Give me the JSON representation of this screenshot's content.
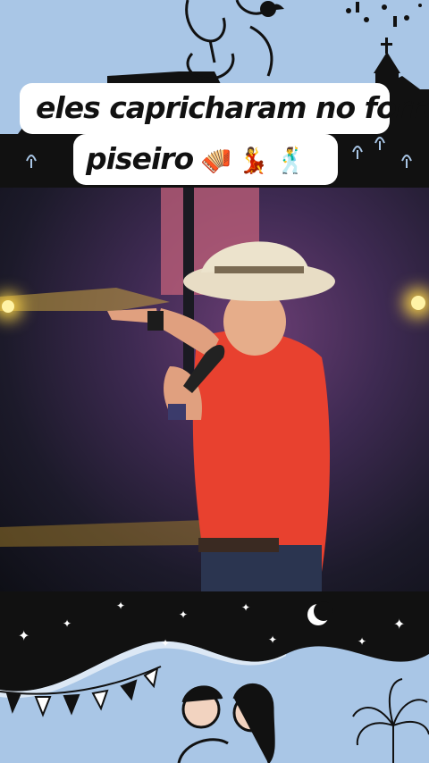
{
  "caption": {
    "line1": "eles capricharam no forró",
    "line2": "piseiro",
    "emojis": [
      "🪗",
      "💃",
      "🕺"
    ]
  },
  "colors": {
    "sky": "#a9c6e6",
    "caption_bg": "#ffffff",
    "shirt": "#e8412f",
    "hat": "#e8ddc5"
  },
  "icons": [
    "church-silhouette-icon",
    "couple-dancing-icon",
    "moon-icon",
    "star-icon",
    "bunting-flags-icon",
    "firework-icon"
  ]
}
